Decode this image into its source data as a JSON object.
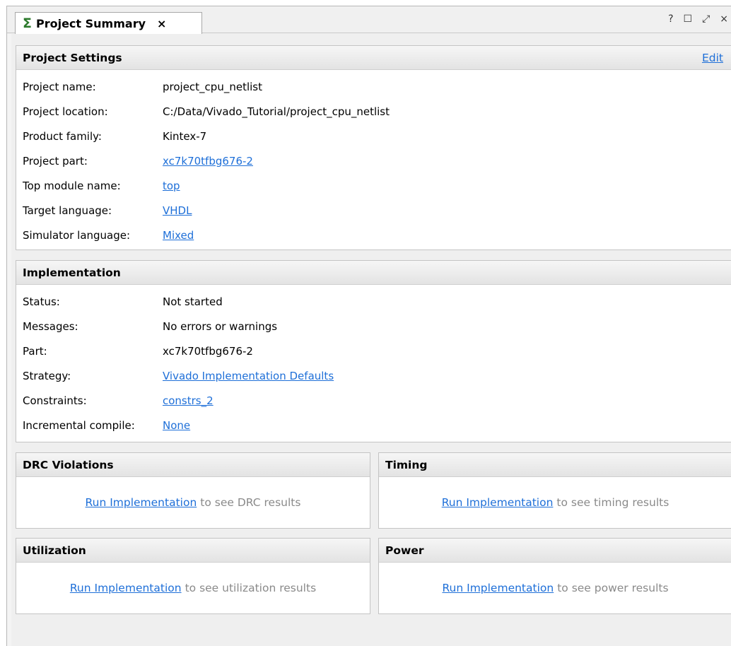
{
  "tab": {
    "icon": "sigma-icon",
    "title": "Project Summary",
    "close": "×"
  },
  "window_controls": {
    "help": "?",
    "maximize": "☐",
    "float": "⤢",
    "close": "×"
  },
  "project_settings": {
    "title": "Project Settings",
    "edit_label": "Edit",
    "rows": [
      {
        "label": "Project name:",
        "value": "project_cpu_netlist",
        "link": false
      },
      {
        "label": "Project location:",
        "value": "C:/Data/Vivado_Tutorial/project_cpu_netlist",
        "link": false
      },
      {
        "label": "Product family:",
        "value": "Kintex-7",
        "link": false
      },
      {
        "label": "Project part:",
        "value": "xc7k70tfbg676-2",
        "link": true
      },
      {
        "label": "Top module name:",
        "value": "top",
        "link": true
      },
      {
        "label": "Target language:",
        "value": "VHDL",
        "link": true
      },
      {
        "label": "Simulator language:",
        "value": "Mixed",
        "link": true
      }
    ]
  },
  "implementation": {
    "title": "Implementation",
    "rows": [
      {
        "label": "Status:",
        "value": "Not started",
        "link": false
      },
      {
        "label": "Messages:",
        "value": "No errors or warnings",
        "link": false
      },
      {
        "label": "Part:",
        "value": "xc7k70tfbg676-2",
        "link": false
      },
      {
        "label": "Strategy:",
        "value": "Vivado Implementation Defaults",
        "link": true
      },
      {
        "label": "Constraints:",
        "value": "constrs_2",
        "link": true
      },
      {
        "label": "Incremental compile:",
        "value": "None",
        "link": true
      }
    ]
  },
  "drc": {
    "title": "DRC Violations",
    "link": "Run Implementation",
    "text": "to see DRC results"
  },
  "timing": {
    "title": "Timing",
    "link": "Run Implementation",
    "text": "to see timing results"
  },
  "utilization": {
    "title": "Utilization",
    "link": "Run Implementation",
    "text": "to see utilization results"
  },
  "power": {
    "title": "Power",
    "link": "Run Implementation",
    "text": "to see power results"
  },
  "colors": {
    "link": "#1e6fd8",
    "sigma": "#2c7a2c",
    "muted_text": "#8a8a8a"
  }
}
